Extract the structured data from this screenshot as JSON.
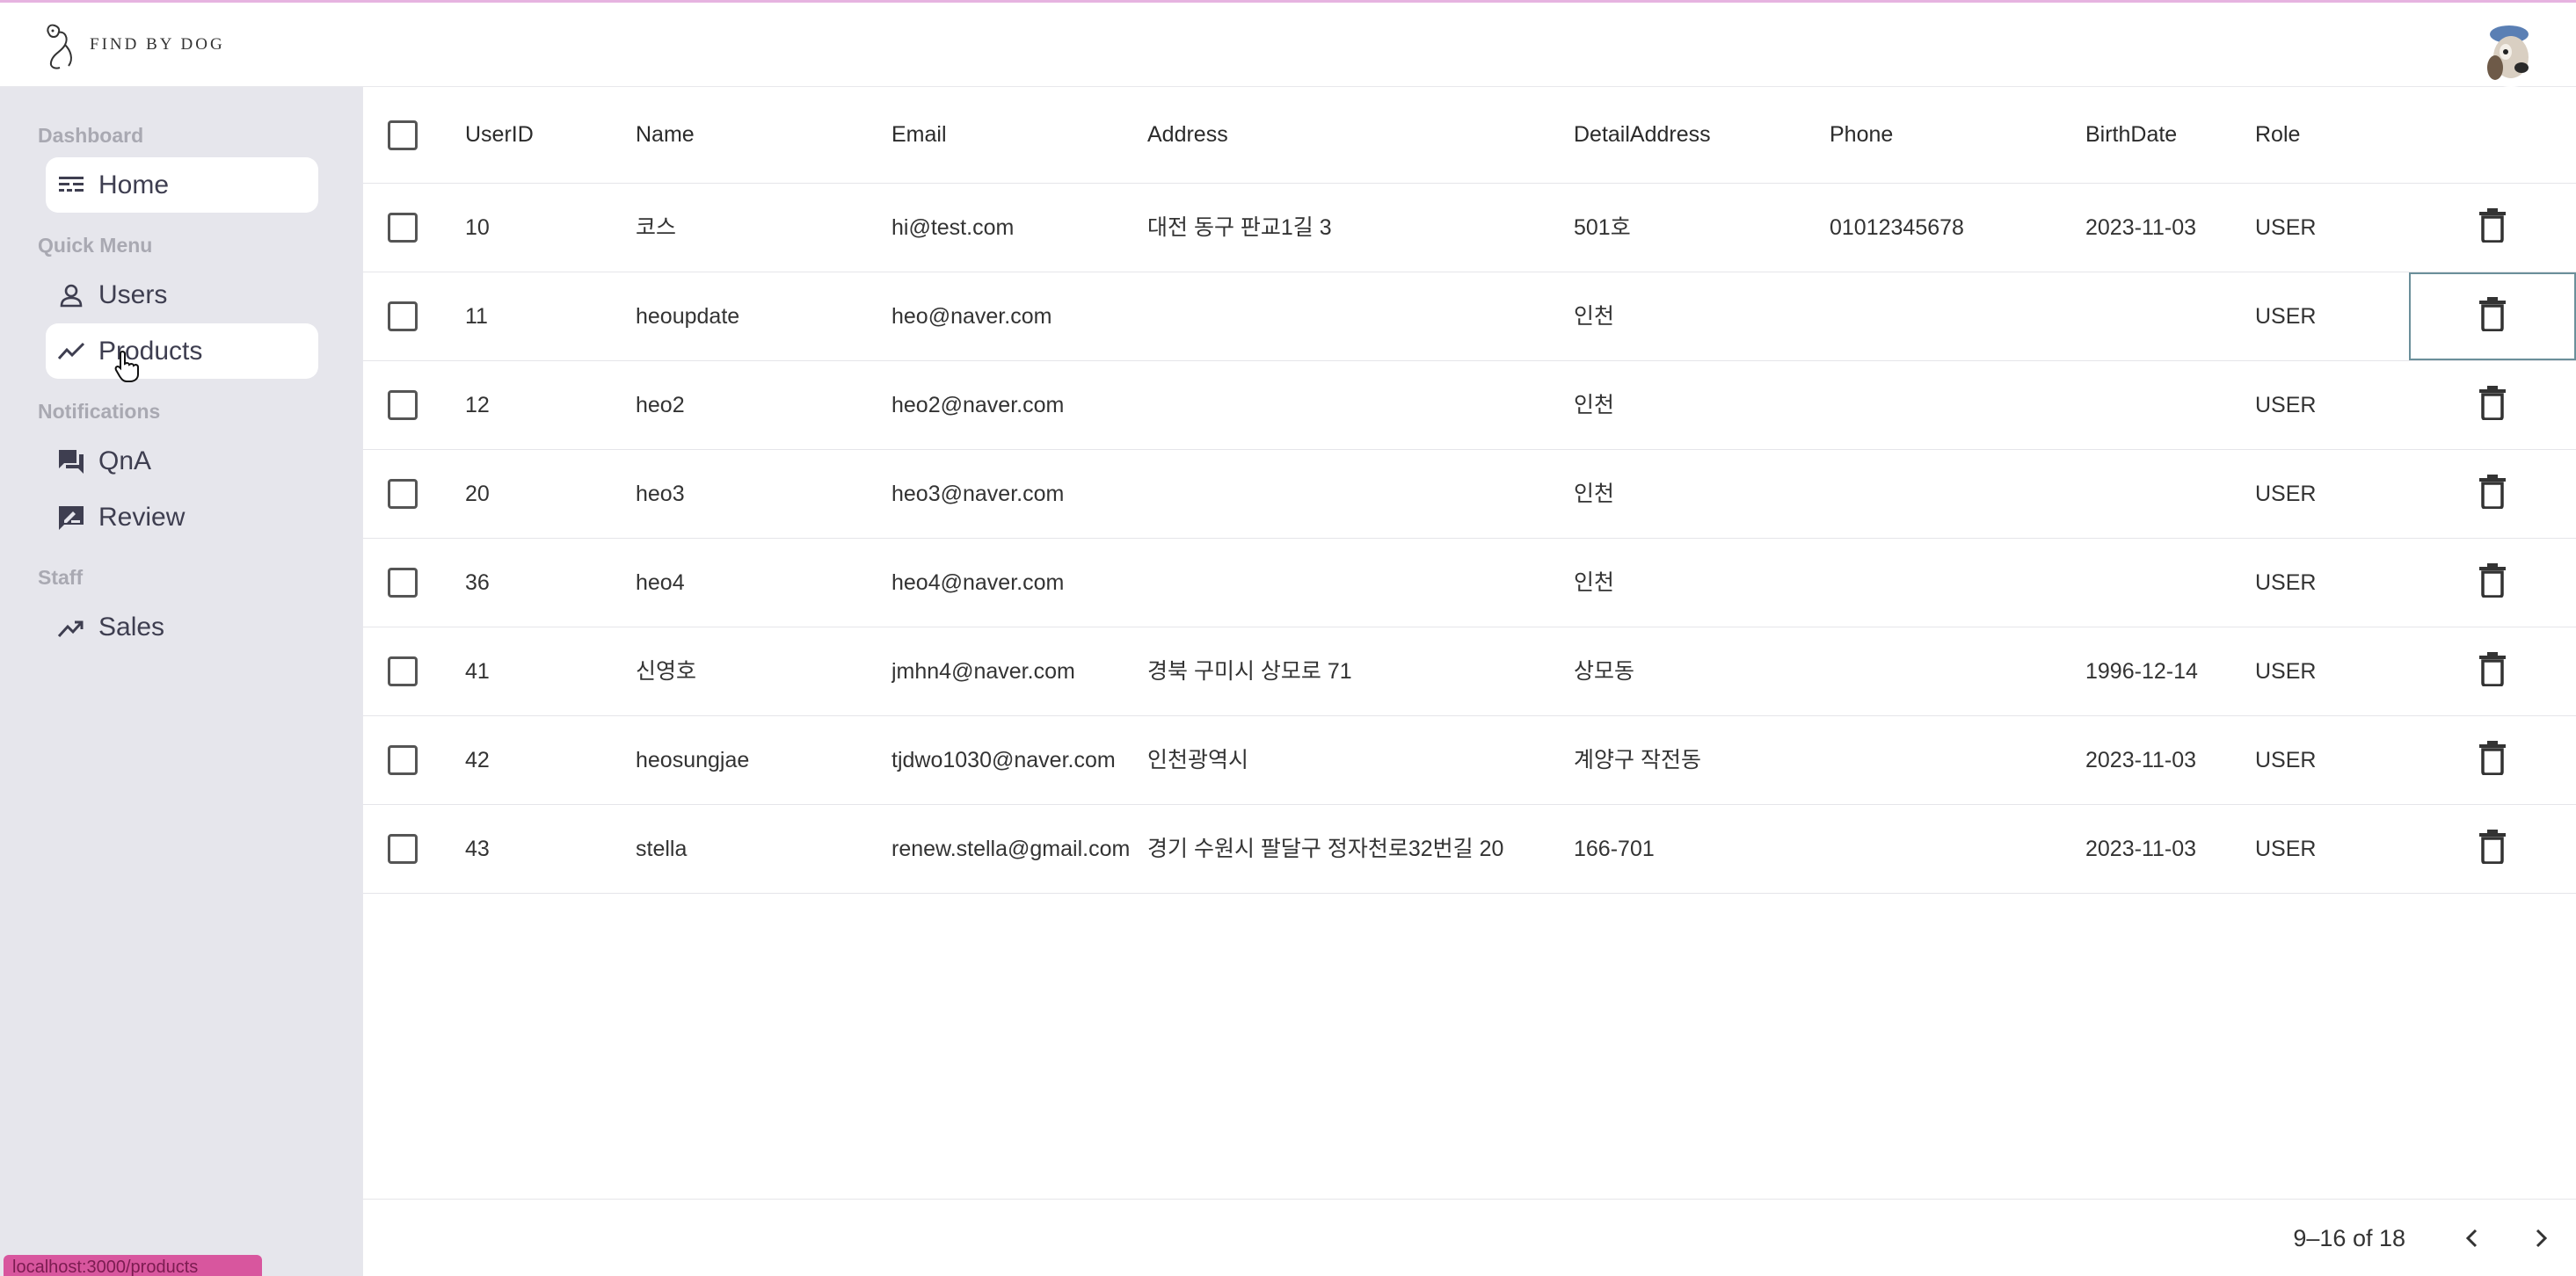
{
  "brand": {
    "name": "FIND BY DOG"
  },
  "sidebar": {
    "sections": [
      {
        "title": "Dashboard",
        "items": [
          {
            "label": "Home",
            "icon": "dashboard-icon",
            "active": true
          }
        ]
      },
      {
        "title": "Quick Menu",
        "items": [
          {
            "label": "Users",
            "icon": "user-icon"
          },
          {
            "label": "Products",
            "icon": "trending-icon",
            "active": true
          }
        ]
      },
      {
        "title": "Notifications",
        "items": [
          {
            "label": "QnA",
            "icon": "forum-icon"
          },
          {
            "label": "Review",
            "icon": "rate-review-icon"
          }
        ]
      },
      {
        "title": "Staff",
        "items": [
          {
            "label": "Sales",
            "icon": "trending-up-icon"
          }
        ]
      }
    ]
  },
  "table": {
    "columns": [
      "UserID",
      "Name",
      "Email",
      "Address",
      "DetailAddress",
      "Phone",
      "BirthDate",
      "Role"
    ],
    "rows": [
      {
        "id": "10",
        "name": "코스",
        "email": "hi@test.com",
        "address": "대전 동구 판교1길 3",
        "detail": "501호",
        "phone": "01012345678",
        "birth": "2023-11-03",
        "role": "USER"
      },
      {
        "id": "11",
        "name": "heoupdate",
        "email": "heo@naver.com",
        "address": "",
        "detail": "인천",
        "phone": "",
        "birth": "",
        "role": "USER"
      },
      {
        "id": "12",
        "name": "heo2",
        "email": "heo2@naver.com",
        "address": "",
        "detail": "인천",
        "phone": "",
        "birth": "",
        "role": "USER"
      },
      {
        "id": "20",
        "name": "heo3",
        "email": "heo3@naver.com",
        "address": "",
        "detail": "인천",
        "phone": "",
        "birth": "",
        "role": "USER"
      },
      {
        "id": "36",
        "name": "heo4",
        "email": "heo4@naver.com",
        "address": "",
        "detail": "인천",
        "phone": "",
        "birth": "",
        "role": "USER"
      },
      {
        "id": "41",
        "name": "신영호",
        "email": "jmhn4@naver.com",
        "address": "경북 구미시 상모로 71",
        "detail": "상모동",
        "phone": "",
        "birth": "1996-12-14",
        "role": "USER"
      },
      {
        "id": "42",
        "name": "heosungjae",
        "email": "tjdwo1030@naver.com",
        "address": "인천광역시",
        "detail": "계양구 작전동",
        "phone": "",
        "birth": "2023-11-03",
        "role": "USER"
      },
      {
        "id": "43",
        "name": "stella",
        "email": "renew.stella@gmail.com",
        "address": "경기 수원시 팔달구 정자천로32번길 20",
        "detail": "166-701",
        "phone": "",
        "birth": "2023-11-03",
        "role": "USER"
      }
    ]
  },
  "pagination": {
    "label": "9–16 of 18"
  },
  "status_bar": {
    "url": "localhost:3000/products"
  }
}
